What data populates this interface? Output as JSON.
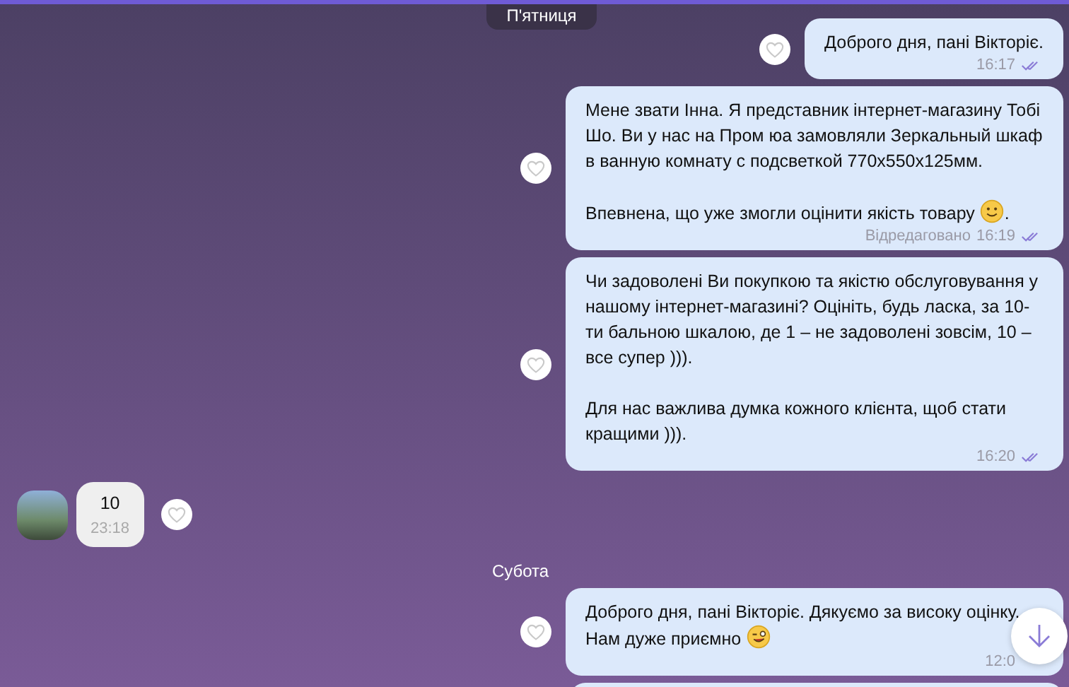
{
  "messages": [
    {
      "kind": "date",
      "text": "П'ятниця",
      "sticky": true
    },
    {
      "kind": "outgoing",
      "paragraphs": [
        {
          "text": "Доброго дня, пані Вікторіє."
        }
      ],
      "time": "16:17",
      "read": true
    },
    {
      "kind": "outgoing",
      "paragraphs": [
        {
          "text": "Мене звати Інна. Я представник інтернет-магазину Тобі Шо. Ви у нас на Пром юа замовляли Зеркальный шкаф в ванную комнату с подсветкой 770х550х125мм."
        },
        {
          "text": "Впевнена, що уже змогли оцінити якість товару",
          "kind": "smile",
          "tail": "."
        }
      ],
      "edited_label": "Відредаговано",
      "time": "16:19",
      "read": true
    },
    {
      "kind": "outgoing",
      "paragraphs": [
        {
          "text": "Чи задоволені Ви покупкою та якістю обслуговування у нашому інтернет-магазині? Оцініть, будь ласка, за 10-ти бальною шкалою, де 1 – не задоволені зовсім, 10 – все супер )))."
        },
        {
          "text": "Для нас важлива думка кожного клієнта, щоб стати кращими )))."
        }
      ],
      "time": "16:20",
      "read": true
    },
    {
      "kind": "incoming",
      "paragraphs": [
        {
          "text": "10"
        }
      ],
      "time": "23:18"
    },
    {
      "kind": "date",
      "text": "Субота",
      "sticky": false
    },
    {
      "kind": "outgoing",
      "paragraphs": [
        {
          "text": "Доброго дня, пані Вікторіє. Дякуємо за високу оцінку. Нам дуже приємно",
          "kind": "wink"
        }
      ],
      "time": "12:0"
    },
    {
      "kind": "outgoing"
    }
  ]
}
